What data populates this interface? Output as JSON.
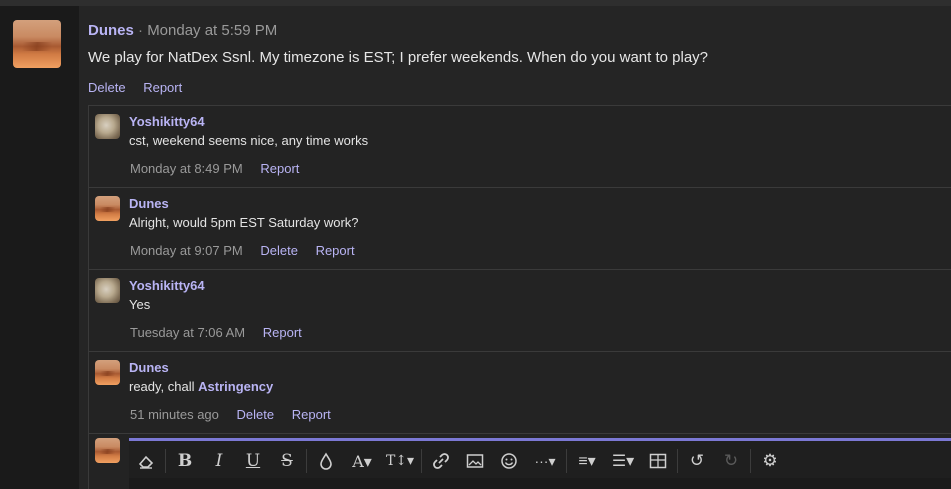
{
  "post": {
    "author": "Dunes",
    "separator": "·",
    "time": "Monday at 5:59 PM",
    "message": "We play for NatDex Ssnl. My timezone is EST; I prefer weekends. When do you want to play?",
    "actions": {
      "delete": "Delete",
      "report": "Report"
    }
  },
  "replies": [
    {
      "author": "Yoshikitty64",
      "text": "cst, weekend seems nice, any time works",
      "time": "Monday at 8:49 PM",
      "report": "Report"
    },
    {
      "author": "Dunes",
      "text": "Alright, would 5pm EST Saturday work?",
      "time": "Monday at 9:07 PM",
      "delete": "Delete",
      "report": "Report"
    },
    {
      "author": "Yoshikitty64",
      "text": "Yes",
      "time": "Tuesday at 7:06 AM",
      "report": "Report"
    },
    {
      "author": "Dunes",
      "text": "ready, chall ",
      "mention": "Astringency",
      "time": "51 minutes ago",
      "delete": "Delete",
      "report": "Report"
    }
  ],
  "toolbar": {
    "eraser": "⌫",
    "bold": "B",
    "italic": "I",
    "underline": "U",
    "strike": "S",
    "color": "💧",
    "font": "A▾",
    "size": "T↕▾",
    "link": "🔗",
    "image": "▣",
    "emoji": "☺",
    "more": "···▾",
    "align": "≡▾",
    "list": "☰▾",
    "table": "⊞",
    "undo": "↺",
    "redo": "↻",
    "settings": "⚙"
  }
}
